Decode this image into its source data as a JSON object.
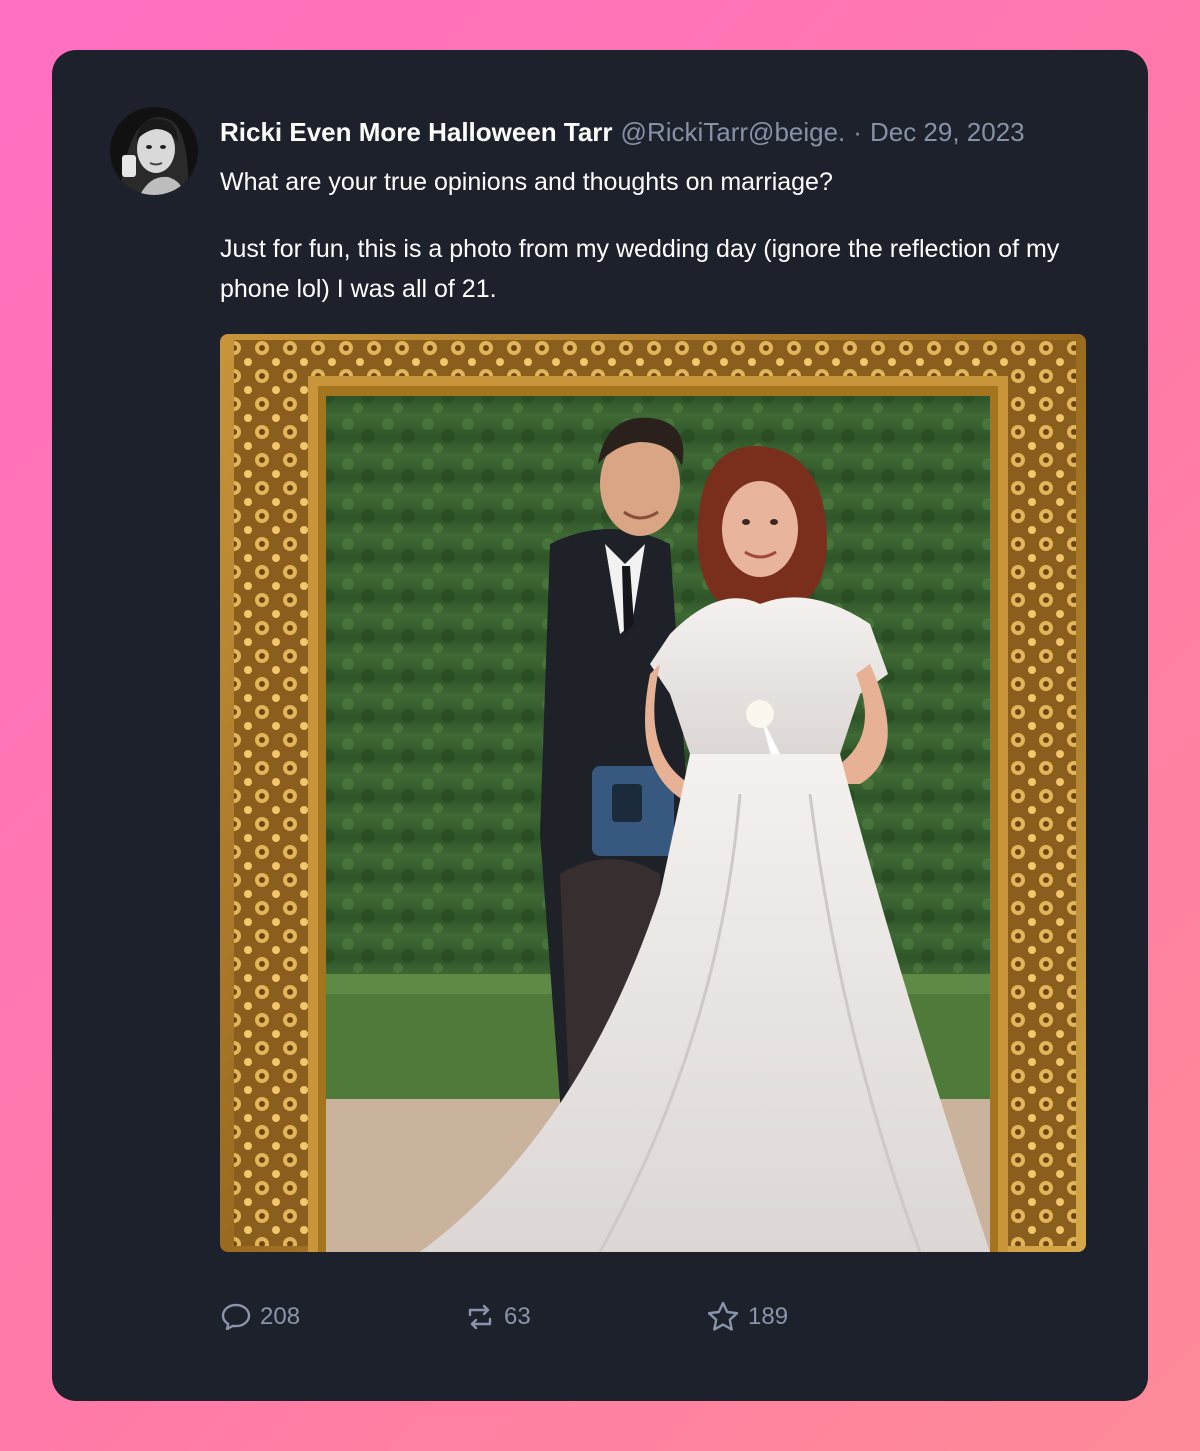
{
  "post": {
    "author": {
      "display_name": "Ricki Even More Halloween Tarr",
      "handle": "@RickiTarr@beige.",
      "avatar_icon": "profile-photo"
    },
    "separator": "·",
    "timestamp": "Dec 29, 2023",
    "text": {
      "paragraph_1": "What are your true opinions and thoughts on marriage?",
      "paragraph_2": "Just for fun, this is a photo from my wedding day (ignore the reflection of my phone lol) I was all of 21."
    },
    "media": {
      "kind": "photo",
      "subject": "framed wedding photo"
    },
    "actions": {
      "replies": {
        "icon": "comment-icon",
        "count": "208"
      },
      "reposts": {
        "icon": "repost-icon",
        "count": "63"
      },
      "likes": {
        "icon": "star-icon",
        "count": "189"
      }
    }
  },
  "colors": {
    "card_background": "#1c212b",
    "text_primary": "#ffffff",
    "text_muted": "#8791a8",
    "page_gradient_start": "#ff6fc2",
    "page_gradient_end": "#ff8b98"
  }
}
